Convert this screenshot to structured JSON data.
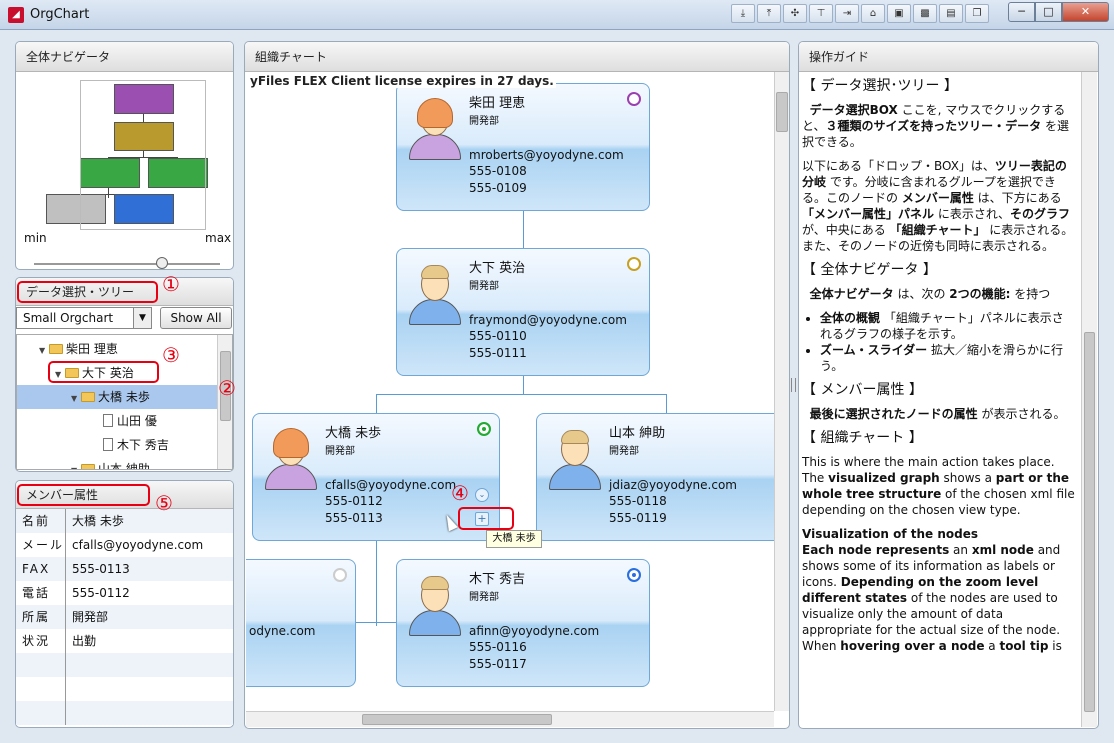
{
  "window": {
    "title": "OrgChart",
    "icon": "app-logo-icon",
    "close_label": "✕",
    "min_label": "─",
    "max_label": "□"
  },
  "toolbar_icons": [
    "tool1-icon",
    "tool2-icon",
    "tool3-icon",
    "tool4-icon",
    "tool5-icon",
    "tool6-icon",
    "tool7-icon",
    "tool8-icon",
    "tool9-icon",
    "tool10-icon",
    "tool11-icon"
  ],
  "navigator": {
    "title": "全体ナビゲータ",
    "min_label": "min",
    "max_label": "max"
  },
  "tree_panel": {
    "title": "データ選択・ツリー",
    "combo_value": "Small Orgchart",
    "show_all": "Show All",
    "items": [
      {
        "label": "柴田 理恵"
      },
      {
        "label": "大下 英治"
      },
      {
        "label": "大橋 未歩"
      },
      {
        "label": "山田 優"
      },
      {
        "label": "木下 秀吉"
      },
      {
        "label": "山本 紳助"
      }
    ]
  },
  "member_panel": {
    "title": "メンバー属性",
    "rows": [
      {
        "k": "名前",
        "v": "大橋 未歩"
      },
      {
        "k": "メール",
        "v": "cfalls@yoyodyne.com"
      },
      {
        "k": "FAX",
        "v": "555-0113"
      },
      {
        "k": "電話",
        "v": "555-0112"
      },
      {
        "k": "所属",
        "v": "開発部"
      },
      {
        "k": "状況",
        "v": "出勤"
      }
    ]
  },
  "chart_panel": {
    "title": "組織チャート",
    "license": "yFiles FLEX Client license expires in 27 days.",
    "nodes": [
      {
        "name": "柴田 理恵",
        "dept": "開発部",
        "mail": "mroberts@yoyodyne.com",
        "ph1": "555-0108",
        "ph2": "555-0109",
        "status_color": "#9b3fb0"
      },
      {
        "name": "大下 英治",
        "dept": "開発部",
        "mail": "fraymond@yoyodyne.com",
        "ph1": "555-0110",
        "ph2": "555-0111",
        "status_color": "#c8a020"
      },
      {
        "name": "大橋 未歩",
        "dept": "開発部",
        "mail": "cfalls@yoyodyne.com",
        "ph1": "555-0112",
        "ph2": "555-0113",
        "status_color": "#22aa33"
      },
      {
        "name": "山本 紳助",
        "dept": "開発部",
        "mail": "jdiaz@yoyodyne.com",
        "ph1": "555-0118",
        "ph2": "555-0119",
        "status_color": "#cccccc"
      },
      {
        "name": "",
        "dept": "",
        "mail": "odyne.com",
        "ph1": "",
        "ph2": "",
        "status_color": "#cccccc"
      },
      {
        "name": "木下 秀吉",
        "dept": "開発部",
        "mail": "afinn@yoyodyne.com",
        "ph1": "555-0116",
        "ph2": "555-0117",
        "status_color": "#2a6fe0"
      }
    ],
    "tooltip": "大橋 未歩",
    "plus": "+",
    "chev": "⌄"
  },
  "annotations": {
    "n1": "①",
    "n2": "②",
    "n3": "③",
    "n4": "④",
    "n5": "⑤"
  },
  "guide": {
    "title": "操作ガイド",
    "h1": "【 データ選択･ツリー 】",
    "p1a": "データ選択BOX",
    "p1b": " ここを, マウスでクリックすると、",
    "p1c": "３種類のサイズを持ったツリー・データ",
    "p1d": " を選択できる。",
    "p2a": "以下にある「ドロップ・BOX」は、",
    "p2b": "ツリー表記の分岐",
    "p2c": " です。分岐に含まれるグループを選択できる。このノードの ",
    "p2d": "メンバー属性",
    "p2e": " は、下方にある ",
    "p2f": "「メンバー属性」パネル",
    "p2g": " に表示され、",
    "p2h": "そのグラフ",
    "p2i": " が、中央にある ",
    "p2j": "「組織チャート」",
    "p2k": " に表示される。また、そのノードの近傍も同時に表示される。",
    "h2": "【 全体ナビゲータ 】",
    "p3a": "全体ナビゲータ",
    "p3b": " は、次の ",
    "p3c": "2つの機能:",
    "p3d": " を持つ",
    "li1a": "全体の概観",
    "li1b": " 「組織チャート」パネルに表示されるグラフの様子を示す。",
    "li2a": "ズーム・スライダー",
    "li2b": " 拡大／縮小を滑らかに行う。",
    "h3": "【 メンバー属性 】",
    "p4a": "最後に選択されたノードの属性",
    "p4b": " が表示される。",
    "h4": "【 組織チャート 】",
    "p5a": "This is where the main action takes place. The ",
    "p5b": "visualized graph",
    "p5c": " shows a ",
    "p5d": "part or the whole tree structure",
    "p5e": " of the chosen xml file depending on the chosen view type.",
    "p6a": "Visualization of the nodes",
    "p6b": "Each node represents",
    "p6c": " an ",
    "p6d": "xml node",
    "p6e": " and shows some of its information as labels or icons. ",
    "p6f": "Depending on the zoom level different states",
    "p6g": " of the nodes are used to visualize only the amount of data appropriate for the actual size of the node.",
    "p7a": " When ",
    "p7b": "hovering over a node",
    "p7c": " a ",
    "p7d": "tool tip",
    "p7e": " is"
  }
}
